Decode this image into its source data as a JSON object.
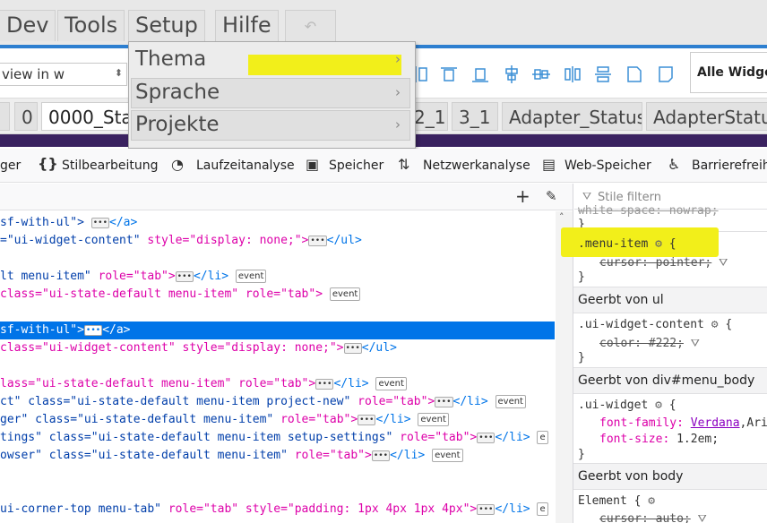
{
  "menubar": {
    "items": [
      "Dev",
      "Tools",
      "Setup",
      "Hilfe"
    ],
    "undo_icon": "undo-icon"
  },
  "toolbar": {
    "view_select": "view in w",
    "widget_select": "Alle Widget"
  },
  "tabs": {
    "first": "0",
    "current": "0000_Sta",
    "t2": "2_1",
    "t3": "3_1",
    "t4": "Adapter_Status",
    "t5": "AdapterStatus"
  },
  "dropdown": {
    "items": [
      "Thema",
      "Sprache",
      "Projekte"
    ]
  },
  "devtools": {
    "tools": [
      "ger",
      "Stilbearbeitung",
      "Laufzeitanalyse",
      "Speicher",
      "Netzwerkanalyse",
      "Web-Speicher",
      "Barrierefreihe"
    ]
  },
  "code": {
    "l1a": "sf-with-ul\">",
    "l1b": "</a>",
    "l2a": "=\"ui-widget-content\"",
    "l2b": " style=\"display: none;\">",
    "l2c": "</ul>",
    "l3a": "lt menu-item\"",
    "l3b": " role=\"tab\">",
    "l3c": "</li>",
    "ev": "event",
    "l4a": " class=\"ui-state-default menu-item\"",
    "l4b": " role=\"tab\">",
    "l5a": " sf-with-ul\">",
    "l5b": "</a>",
    "l6a": "class=\"ui-widget-content\"",
    "l6b": " style=\"display: none;\">",
    "l6c": "</ul>",
    "l7a": "lass=\"ui-state-default menu-item\"",
    "l7b": " role=\"tab\">",
    "l7c": "</li>",
    "l8a": "ct\" class=\"ui-state-default menu-item project-new\"",
    "l8b": " role=\"tab\">",
    "l8c": "</li>",
    "l9a": "ger\" class=\"ui-state-default menu-item\"",
    "l9b": " role=\"tab\">",
    "l9c": "</li>",
    "l10a": "tings\" class=\"ui-state-default menu-item setup-settings\"",
    "l10b": " role=\"tab\">",
    "l10c": "</li>",
    "l10d": "e",
    "l11a": "owser\" class=\"ui-state-default menu-item\"",
    "l11b": " role=\"tab\">",
    "l11c": "</li>",
    "l12a": "ui-corner-top menu-tab\"",
    "l12b": " role=\"tab\"",
    "l12c": " style=\"padding: 1px 4px 1px 4px\">",
    "l12d": "</li>",
    "l12e": "e"
  },
  "rules": {
    "filter_placeholder": "Stile filtern",
    "top_prop": "white-space: nowrap;",
    "close": "}",
    "sel1": ".menu-item",
    "open": " {",
    "p1": "cursor: pointer;",
    "h1": "Geerbt von ul",
    "sel2": ".ui-widget-content",
    "p2": "color: #222;",
    "h2": "Geerbt von div#menu_body",
    "sel3": ".ui-widget",
    "p3name": "font-family: ",
    "p3val": "Verdana",
    "p3rest": ",Ari",
    "p4name": "font-size: ",
    "p4val": "1.2em;",
    "h3": "Geerbt von body",
    "sel4": "Element",
    "p5": "cursor: auto;"
  },
  "colors": {
    "highlight": "#f2ef1a",
    "selection": "#0074e8",
    "accent_line": "#2d7fd0"
  }
}
